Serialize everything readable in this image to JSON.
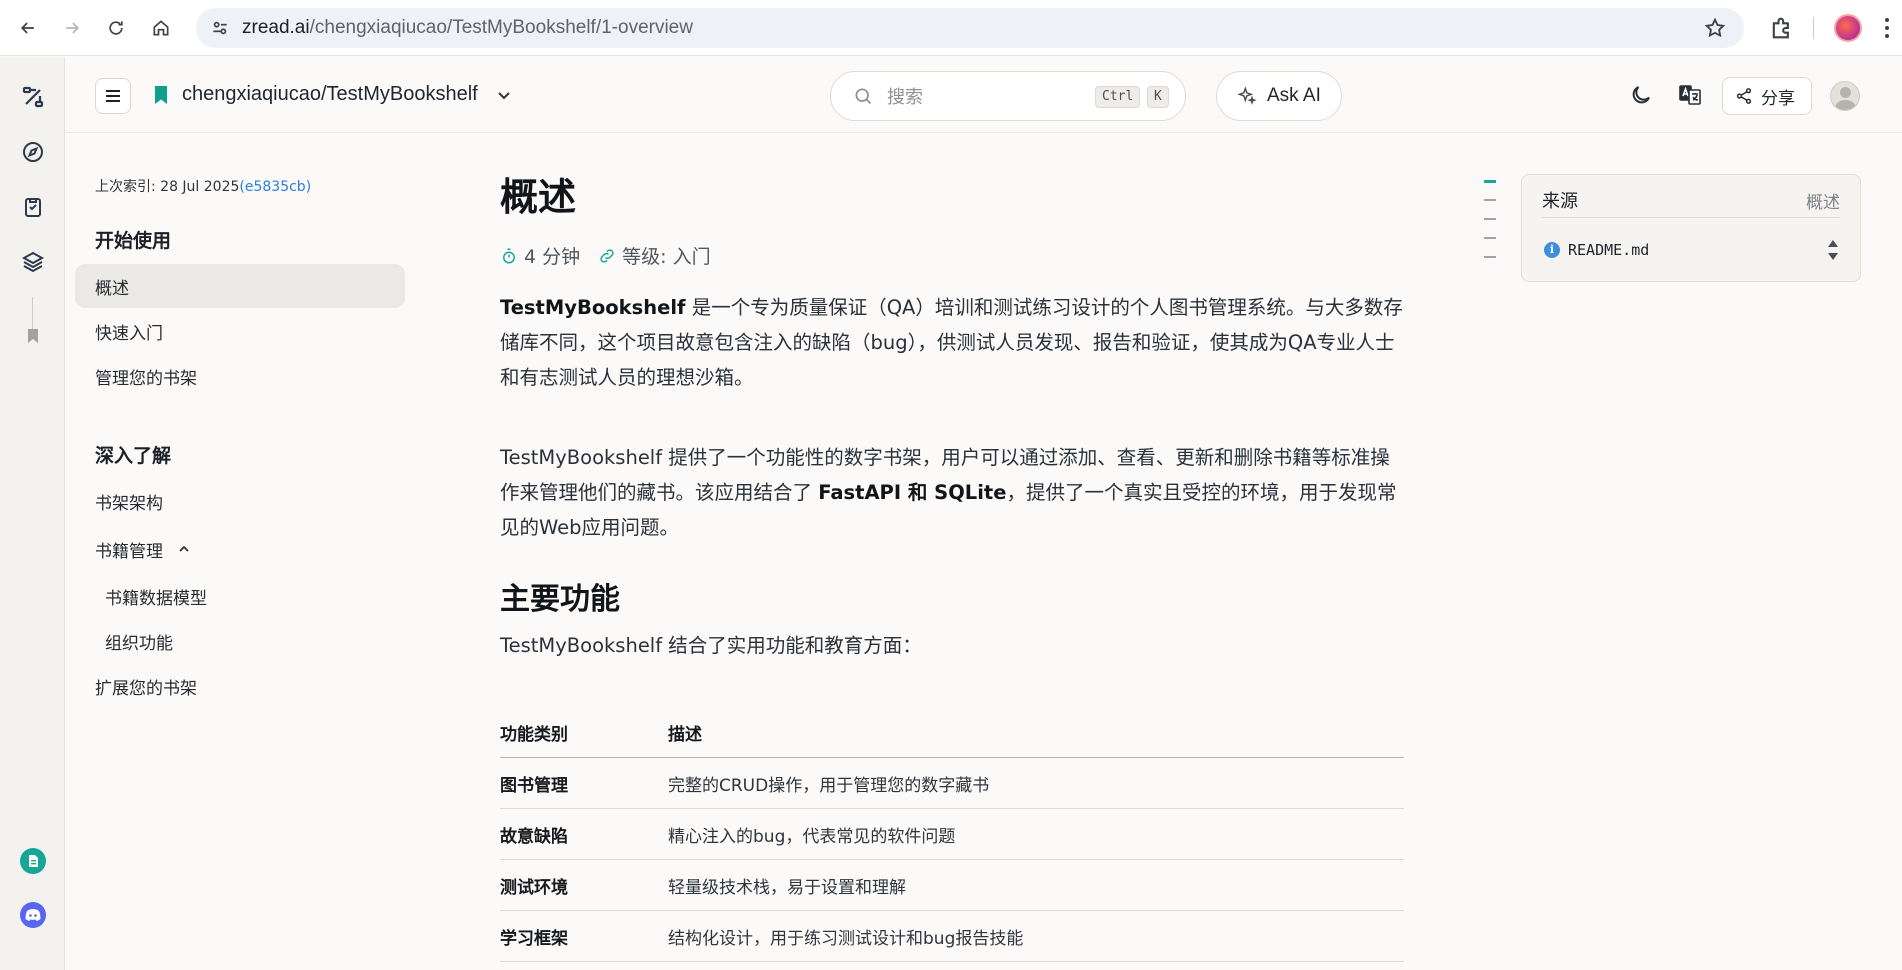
{
  "browser": {
    "url_host": "zread.ai",
    "url_path": "/chengxiaqiucao/TestMyBookshelf/1-overview"
  },
  "header": {
    "repo_name": "chengxiaqiucao/TestMyBookshelf",
    "search_placeholder": "搜索",
    "search_shortcut_mod": "Ctrl",
    "search_shortcut_key": "K",
    "ask_ai_label": "Ask AI",
    "share_label": "分享"
  },
  "sidebar": {
    "last_index_label": "上次索引: 28 Jul 2025",
    "last_index_hash": "(e5835cb)",
    "sections": [
      {
        "title": "开始使用",
        "items": [
          {
            "label": "概述",
            "active": true
          },
          {
            "label": "快速入门"
          },
          {
            "label": "管理您的书架"
          }
        ]
      },
      {
        "title": "深入了解",
        "items": [
          {
            "label": "书架架构"
          },
          {
            "label": "书籍管理",
            "expanded": true
          },
          {
            "label": "书籍数据模型",
            "sub": true
          },
          {
            "label": "组织功能",
            "sub": true
          },
          {
            "label": "扩展您的书架"
          }
        ]
      }
    ]
  },
  "article": {
    "title": "概述",
    "read_time": "4 分钟",
    "level": "等级: 入门",
    "p1_strong": "TestMyBookshelf",
    "p1_rest": " 是一个专为质量保证（QA）培训和测试练习设计的个人图书管理系统。与大多数存储库不同，这个项目故意包含注入的缺陷（bug），供测试人员发现、报告和验证，使其成为QA专业人士和有志测试人员的理想沙箱。",
    "p2_a": "TestMyBookshelf 提供了一个功能性的数字书架，用户可以通过添加、查看、更新和删除书籍等标准操作来管理他们的藏书。该应用结合了 ",
    "p2_strong": "FastAPI 和 SQLite",
    "p2_b": "，提供了一个真实且受控的环境，用于发现常见的Web应用问题。",
    "h2": "主要功能",
    "p3": "TestMyBookshelf 结合了实用功能和教育方面：",
    "table": {
      "headers": [
        "功能类别",
        "描述"
      ],
      "rows": [
        [
          "图书管理",
          "完整的CRUD操作，用于管理您的数字藏书"
        ],
        [
          "故意缺陷",
          "精心注入的bug，代表常见的软件问题"
        ],
        [
          "测试环境",
          "轻量级技术栈，易于设置和理解"
        ],
        [
          "学习框架",
          "结构化设计，用于练习测试设计和bug报告技能"
        ]
      ]
    }
  },
  "source_panel": {
    "title": "来源",
    "right_label": "概述",
    "file": "README.md"
  },
  "colors": {
    "accent": "#17a89a",
    "link": "#2d7fd6"
  }
}
